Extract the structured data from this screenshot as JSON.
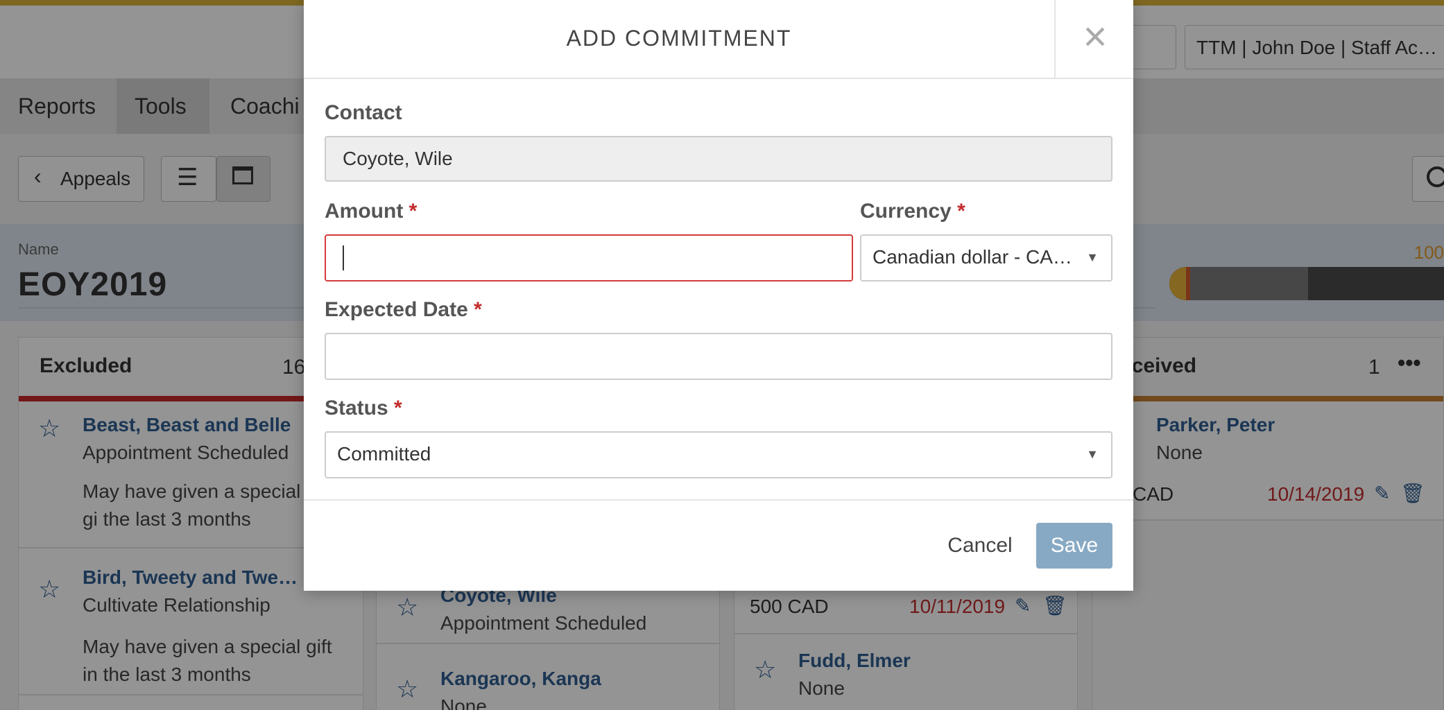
{
  "header": {
    "user_select": "TTM | John Doe | Staff Ac…"
  },
  "nav": {
    "items": [
      "Reports",
      "Tools",
      "Coachi"
    ]
  },
  "toolbar": {
    "back_label": "Appeals"
  },
  "appeal": {
    "name_label": "Name",
    "name": "EOY2019",
    "progress_label": "100"
  },
  "columns": [
    {
      "title": "Excluded",
      "count": "16",
      "cards": [
        {
          "name": "Beast, Beast and Belle",
          "status": "Appointment Scheduled",
          "note": "May have given a special gi the last 3 months"
        },
        {
          "name": "Bird, Tweety and Twe…",
          "status": "Cultivate Relationship",
          "note": "May have given a special gift in the last 3 months"
        }
      ]
    },
    {
      "cards": [
        {
          "name": "Coyote, Wile",
          "status": "Appointment Scheduled"
        },
        {
          "name": "Kangaroo, Kanga",
          "status": "None"
        }
      ]
    },
    {
      "cards": [
        {
          "amount": "500 CAD",
          "date": "10/11/2019"
        },
        {
          "name": "Fudd, Elmer",
          "status": "None"
        }
      ]
    },
    {
      "title": "eceived",
      "count": "1",
      "cards": [
        {
          "name": "Parker, Peter",
          "status": "None",
          "amount": "CAD",
          "date": "10/14/2019"
        }
      ]
    }
  ],
  "modal": {
    "title": "ADD COMMITMENT",
    "contact": {
      "label": "Contact",
      "value": "Coyote, Wile"
    },
    "amount": {
      "label": "Amount",
      "value": ""
    },
    "currency": {
      "label": "Currency",
      "value": "Canadian dollar - CAD…"
    },
    "expected_date": {
      "label": "Expected Date",
      "value": ""
    },
    "status": {
      "label": "Status",
      "value": "Committed"
    },
    "required_mark": "*",
    "cancel_label": "Cancel",
    "save_label": "Save"
  },
  "colors": {
    "accent": "#d9b23a",
    "link": "#2f5e91",
    "danger": "#c22b2b",
    "save": "#88a9c3"
  }
}
